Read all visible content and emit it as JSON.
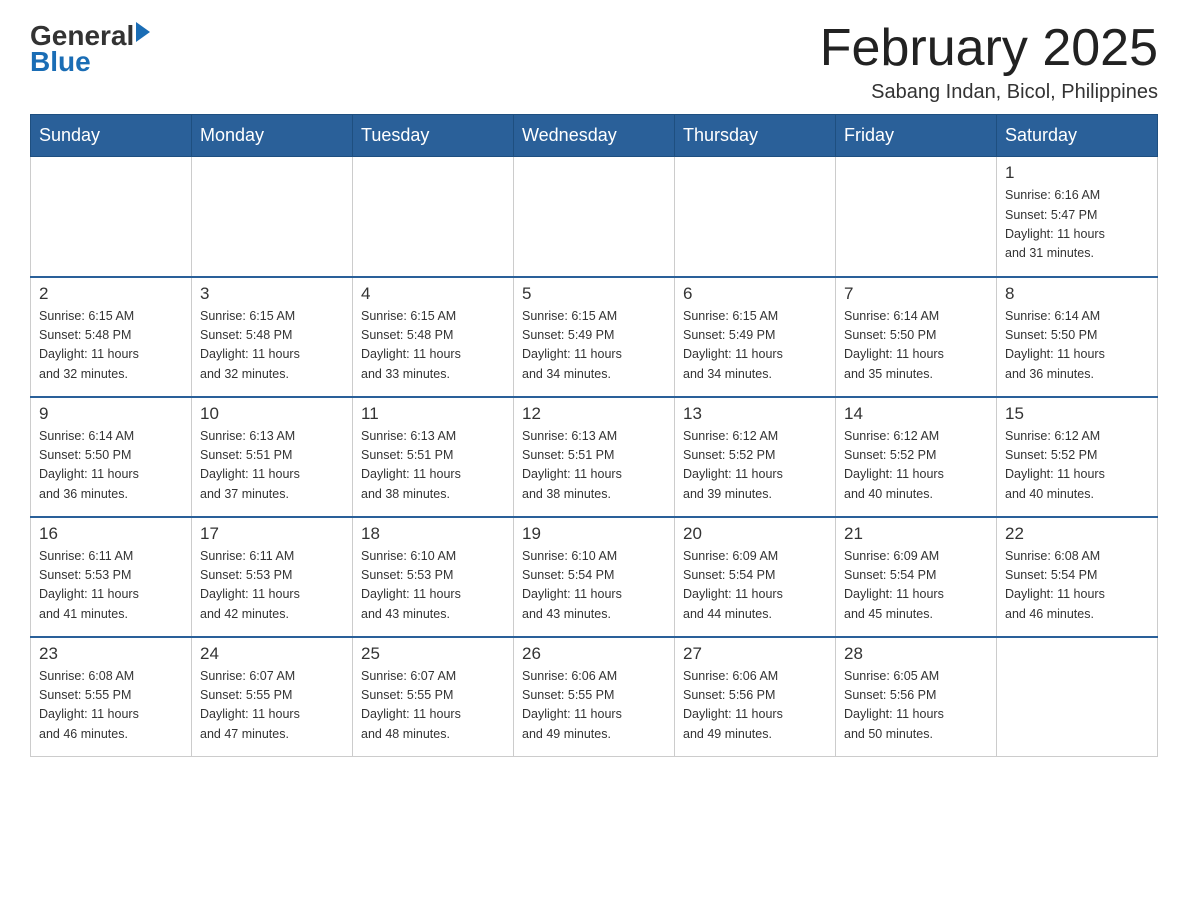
{
  "header": {
    "logo_general": "General",
    "logo_blue": "Blue",
    "title": "February 2025",
    "location": "Sabang Indan, Bicol, Philippines"
  },
  "days_of_week": [
    "Sunday",
    "Monday",
    "Tuesday",
    "Wednesday",
    "Thursday",
    "Friday",
    "Saturday"
  ],
  "weeks": [
    [
      {
        "day": "",
        "info": ""
      },
      {
        "day": "",
        "info": ""
      },
      {
        "day": "",
        "info": ""
      },
      {
        "day": "",
        "info": ""
      },
      {
        "day": "",
        "info": ""
      },
      {
        "day": "",
        "info": ""
      },
      {
        "day": "1",
        "info": "Sunrise: 6:16 AM\nSunset: 5:47 PM\nDaylight: 11 hours\nand 31 minutes."
      }
    ],
    [
      {
        "day": "2",
        "info": "Sunrise: 6:15 AM\nSunset: 5:48 PM\nDaylight: 11 hours\nand 32 minutes."
      },
      {
        "day": "3",
        "info": "Sunrise: 6:15 AM\nSunset: 5:48 PM\nDaylight: 11 hours\nand 32 minutes."
      },
      {
        "day": "4",
        "info": "Sunrise: 6:15 AM\nSunset: 5:48 PM\nDaylight: 11 hours\nand 33 minutes."
      },
      {
        "day": "5",
        "info": "Sunrise: 6:15 AM\nSunset: 5:49 PM\nDaylight: 11 hours\nand 34 minutes."
      },
      {
        "day": "6",
        "info": "Sunrise: 6:15 AM\nSunset: 5:49 PM\nDaylight: 11 hours\nand 34 minutes."
      },
      {
        "day": "7",
        "info": "Sunrise: 6:14 AM\nSunset: 5:50 PM\nDaylight: 11 hours\nand 35 minutes."
      },
      {
        "day": "8",
        "info": "Sunrise: 6:14 AM\nSunset: 5:50 PM\nDaylight: 11 hours\nand 36 minutes."
      }
    ],
    [
      {
        "day": "9",
        "info": "Sunrise: 6:14 AM\nSunset: 5:50 PM\nDaylight: 11 hours\nand 36 minutes."
      },
      {
        "day": "10",
        "info": "Sunrise: 6:13 AM\nSunset: 5:51 PM\nDaylight: 11 hours\nand 37 minutes."
      },
      {
        "day": "11",
        "info": "Sunrise: 6:13 AM\nSunset: 5:51 PM\nDaylight: 11 hours\nand 38 minutes."
      },
      {
        "day": "12",
        "info": "Sunrise: 6:13 AM\nSunset: 5:51 PM\nDaylight: 11 hours\nand 38 minutes."
      },
      {
        "day": "13",
        "info": "Sunrise: 6:12 AM\nSunset: 5:52 PM\nDaylight: 11 hours\nand 39 minutes."
      },
      {
        "day": "14",
        "info": "Sunrise: 6:12 AM\nSunset: 5:52 PM\nDaylight: 11 hours\nand 40 minutes."
      },
      {
        "day": "15",
        "info": "Sunrise: 6:12 AM\nSunset: 5:52 PM\nDaylight: 11 hours\nand 40 minutes."
      }
    ],
    [
      {
        "day": "16",
        "info": "Sunrise: 6:11 AM\nSunset: 5:53 PM\nDaylight: 11 hours\nand 41 minutes."
      },
      {
        "day": "17",
        "info": "Sunrise: 6:11 AM\nSunset: 5:53 PM\nDaylight: 11 hours\nand 42 minutes."
      },
      {
        "day": "18",
        "info": "Sunrise: 6:10 AM\nSunset: 5:53 PM\nDaylight: 11 hours\nand 43 minutes."
      },
      {
        "day": "19",
        "info": "Sunrise: 6:10 AM\nSunset: 5:54 PM\nDaylight: 11 hours\nand 43 minutes."
      },
      {
        "day": "20",
        "info": "Sunrise: 6:09 AM\nSunset: 5:54 PM\nDaylight: 11 hours\nand 44 minutes."
      },
      {
        "day": "21",
        "info": "Sunrise: 6:09 AM\nSunset: 5:54 PM\nDaylight: 11 hours\nand 45 minutes."
      },
      {
        "day": "22",
        "info": "Sunrise: 6:08 AM\nSunset: 5:54 PM\nDaylight: 11 hours\nand 46 minutes."
      }
    ],
    [
      {
        "day": "23",
        "info": "Sunrise: 6:08 AM\nSunset: 5:55 PM\nDaylight: 11 hours\nand 46 minutes."
      },
      {
        "day": "24",
        "info": "Sunrise: 6:07 AM\nSunset: 5:55 PM\nDaylight: 11 hours\nand 47 minutes."
      },
      {
        "day": "25",
        "info": "Sunrise: 6:07 AM\nSunset: 5:55 PM\nDaylight: 11 hours\nand 48 minutes."
      },
      {
        "day": "26",
        "info": "Sunrise: 6:06 AM\nSunset: 5:55 PM\nDaylight: 11 hours\nand 49 minutes."
      },
      {
        "day": "27",
        "info": "Sunrise: 6:06 AM\nSunset: 5:56 PM\nDaylight: 11 hours\nand 49 minutes."
      },
      {
        "day": "28",
        "info": "Sunrise: 6:05 AM\nSunset: 5:56 PM\nDaylight: 11 hours\nand 50 minutes."
      },
      {
        "day": "",
        "info": ""
      }
    ]
  ]
}
